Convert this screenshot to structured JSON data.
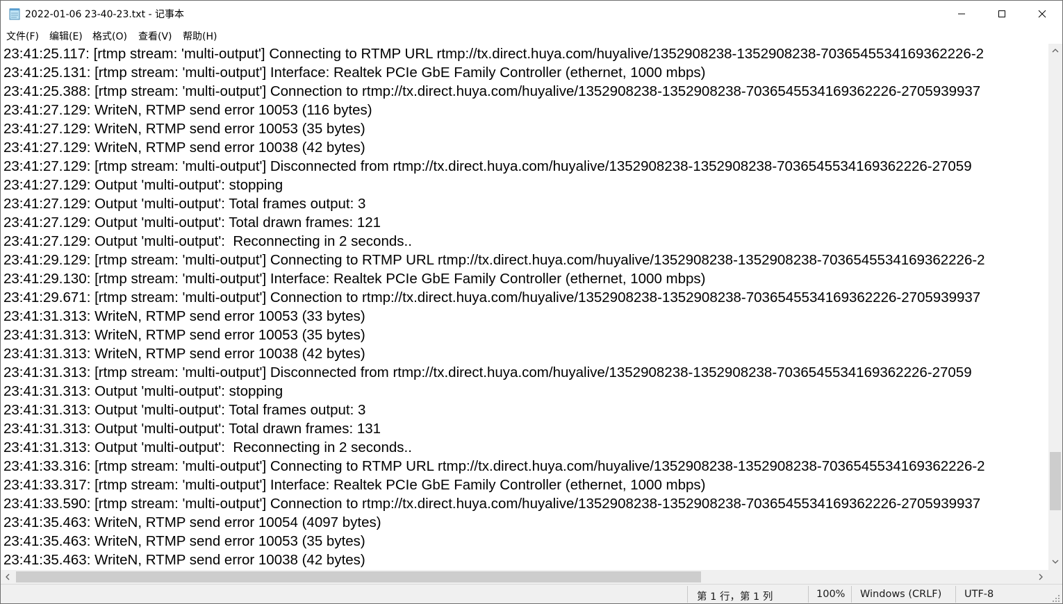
{
  "window": {
    "title": "2022-01-06 23-40-23.txt - 记事本",
    "icons": {
      "app": "notepad-icon",
      "minimize": "minimize-icon",
      "maximize": "maximize-icon",
      "close": "close-icon"
    }
  },
  "menu": {
    "file": "文件(F)",
    "edit": "编辑(E)",
    "format": "格式(O)",
    "view": "查看(V)",
    "help": "帮助(H)"
  },
  "lines": [
    "23:41:25.117: [rtmp stream: 'multi-output'] Connecting to RTMP URL rtmp://tx.direct.huya.com/huyalive/1352908238-1352908238-7036545534169362226-2",
    "23:41:25.131: [rtmp stream: 'multi-output'] Interface: Realtek PCIe GbE Family Controller (ethernet, 1000 mbps)",
    "23:41:25.388: [rtmp stream: 'multi-output'] Connection to rtmp://tx.direct.huya.com/huyalive/1352908238-1352908238-7036545534169362226-2705939937",
    "23:41:27.129: WriteN, RTMP send error 10053 (116 bytes)",
    "23:41:27.129: WriteN, RTMP send error 10053 (35 bytes)",
    "23:41:27.129: WriteN, RTMP send error 10038 (42 bytes)",
    "23:41:27.129: [rtmp stream: 'multi-output'] Disconnected from rtmp://tx.direct.huya.com/huyalive/1352908238-1352908238-7036545534169362226-27059",
    "23:41:27.129: Output 'multi-output': stopping",
    "23:41:27.129: Output 'multi-output': Total frames output: 3",
    "23:41:27.129: Output 'multi-output': Total drawn frames: 121",
    "23:41:27.129: Output 'multi-output':  Reconnecting in 2 seconds..",
    "23:41:29.129: [rtmp stream: 'multi-output'] Connecting to RTMP URL rtmp://tx.direct.huya.com/huyalive/1352908238-1352908238-7036545534169362226-2",
    "23:41:29.130: [rtmp stream: 'multi-output'] Interface: Realtek PCIe GbE Family Controller (ethernet, 1000 mbps)",
    "23:41:29.671: [rtmp stream: 'multi-output'] Connection to rtmp://tx.direct.huya.com/huyalive/1352908238-1352908238-7036545534169362226-2705939937",
    "23:41:31.313: WriteN, RTMP send error 10053 (33 bytes)",
    "23:41:31.313: WriteN, RTMP send error 10053 (35 bytes)",
    "23:41:31.313: WriteN, RTMP send error 10038 (42 bytes)",
    "23:41:31.313: [rtmp stream: 'multi-output'] Disconnected from rtmp://tx.direct.huya.com/huyalive/1352908238-1352908238-7036545534169362226-27059",
    "23:41:31.313: Output 'multi-output': stopping",
    "23:41:31.313: Output 'multi-output': Total frames output: 3",
    "23:41:31.313: Output 'multi-output': Total drawn frames: 131",
    "23:41:31.313: Output 'multi-output':  Reconnecting in 2 seconds..",
    "23:41:33.316: [rtmp stream: 'multi-output'] Connecting to RTMP URL rtmp://tx.direct.huya.com/huyalive/1352908238-1352908238-7036545534169362226-2",
    "23:41:33.317: [rtmp stream: 'multi-output'] Interface: Realtek PCIe GbE Family Controller (ethernet, 1000 mbps)",
    "23:41:33.590: [rtmp stream: 'multi-output'] Connection to rtmp://tx.direct.huya.com/huyalive/1352908238-1352908238-7036545534169362226-2705939937",
    "23:41:35.463: WriteN, RTMP send error 10054 (4097 bytes)",
    "23:41:35.463: WriteN, RTMP send error 10053 (35 bytes)",
    "23:41:35.463: WriteN, RTMP send error 10038 (42 bytes)"
  ],
  "status": {
    "position": "第 1 行，第 1 列",
    "zoom": "100%",
    "line_ending": "Windows (CRLF)",
    "encoding": "UTF-8"
  },
  "colors": {
    "scroll_track": "#f0f0f0",
    "scroll_thumb": "#cdcdcd",
    "status_bg": "#f0f0f0"
  }
}
